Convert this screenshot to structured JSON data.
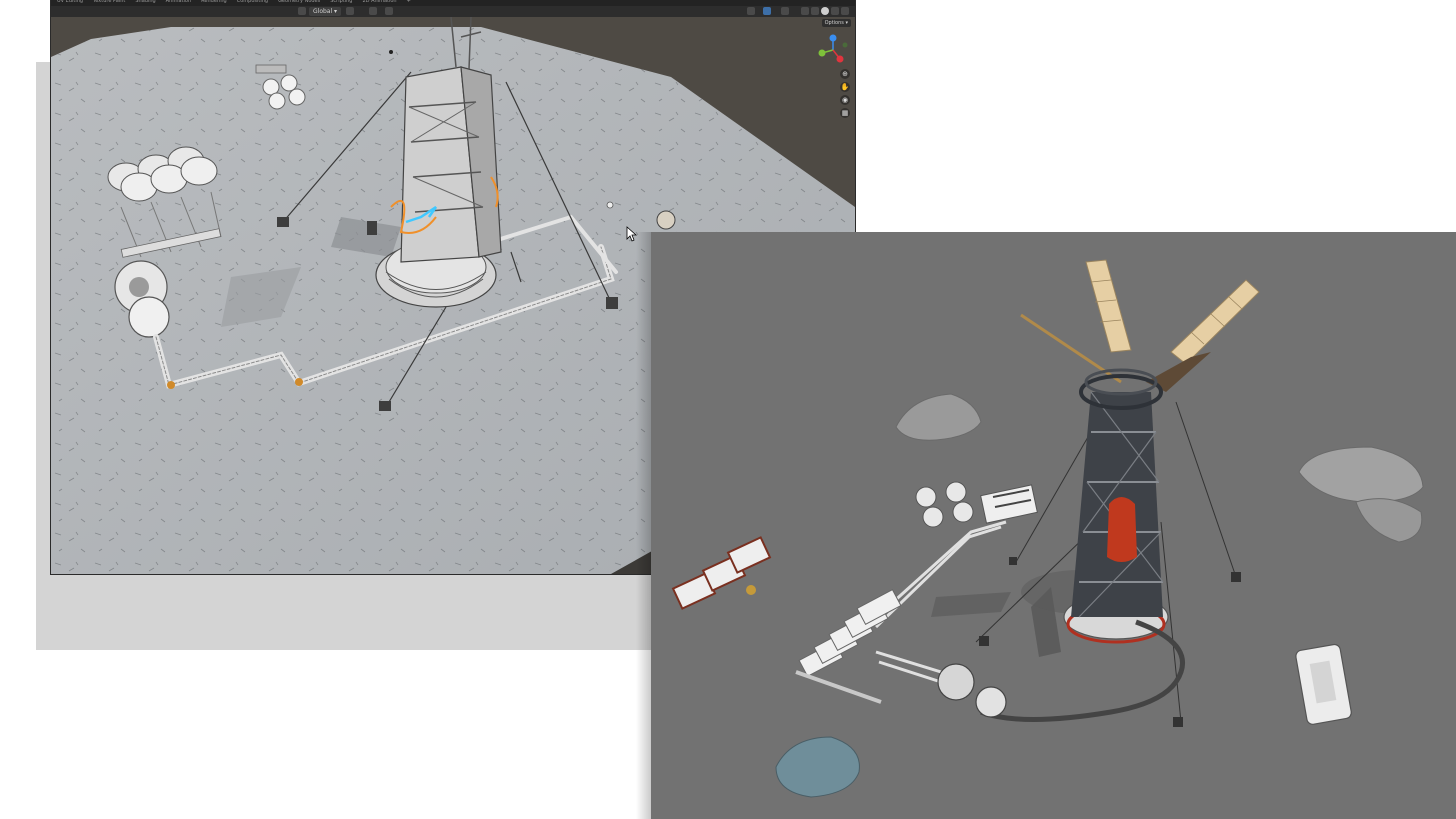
{
  "workspace_tabs": [
    "UV Editing",
    "Texture Paint",
    "Shading",
    "Animation",
    "Rendering",
    "Compositing",
    "Geometry Nodes",
    "Scripting",
    "2D Animation",
    "+"
  ],
  "header": {
    "transform_orientation": "Global",
    "options_label": "Options"
  },
  "navigation": {
    "icons": [
      "zoom-icon",
      "pan-hand-icon",
      "camera-icon",
      "grid-view-icon"
    ]
  },
  "colors": {
    "editor_bg": "#3a3a3a",
    "topbar": "#232323",
    "selection_outline": "#f0902a",
    "active_highlight": "#40c8ff",
    "render_bg": "#707070",
    "gizmo_x": "#e0353e",
    "gizmo_y": "#7ec13a",
    "gizmo_z": "#3a8ef0"
  }
}
